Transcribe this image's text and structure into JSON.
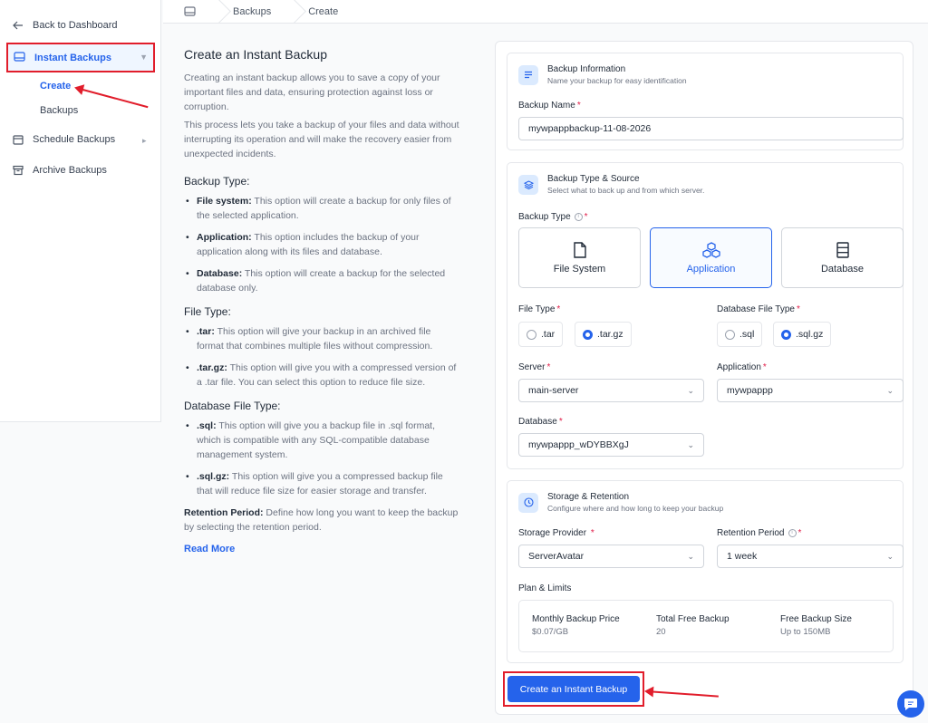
{
  "sidebar": {
    "back_label": "Back to Dashboard",
    "instant_backups_label": "Instant Backups",
    "sub_items": [
      "Create",
      "Backups"
    ],
    "schedule_backups_label": "Schedule Backups",
    "archive_backups_label": "Archive Backups"
  },
  "breadcrumb": [
    "Backups",
    "Create"
  ],
  "info": {
    "title": "Create an Instant Backup",
    "intro1": "Creating an instant backup allows you to save a copy of your important files and data, ensuring protection against loss or corruption.",
    "intro2": "This process lets you take a backup of your files and data without interrupting its operation and will make the recovery easier from unexpected incidents.",
    "backup_type_heading": "Backup Type:",
    "backup_types": [
      {
        "term": "File system:",
        "desc": " This option will create a backup for only files of the selected application."
      },
      {
        "term": "Application:",
        "desc": " This option includes the backup of your application along with its files and database."
      },
      {
        "term": "Database:",
        "desc": " This option will create a backup for the selected database only."
      }
    ],
    "file_type_heading": "File Type:",
    "file_types": [
      {
        "term": ".tar:",
        "desc": " This option will give your backup in an archived file format that combines multiple files without compression."
      },
      {
        "term": ".tar.gz:",
        "desc": " This option will give you with a compressed version of a .tar file. You can select this option to reduce file size."
      }
    ],
    "db_file_type_heading": "Database File Type:",
    "db_file_types": [
      {
        "term": ".sql:",
        "desc": " This option will give you a backup file in .sql format, which is compatible with any SQL-compatible database management system."
      },
      {
        "term": ".sql.gz:",
        "desc": " This option will give you a compressed backup file that will reduce file size for easier storage and transfer."
      }
    ],
    "retention_term": "Retention Period:",
    "retention_desc": " Define how long you want to keep the backup by selecting the retention period.",
    "read_more": "Read More"
  },
  "form": {
    "backup_info": {
      "title": "Backup Information",
      "subtitle": "Name your backup for easy identification",
      "name_label": "Backup Name",
      "name_value": "mywpappbackup-11-08-2026"
    },
    "type_source": {
      "title": "Backup Type & Source",
      "subtitle": "Select what to back up and from which server.",
      "backup_type_label": "Backup Type",
      "types": [
        "File System",
        "Application",
        "Database"
      ],
      "selected_type": "Application",
      "file_type_label": "File Type",
      "file_types": [
        ".tar",
        ".tar.gz"
      ],
      "selected_file_type": ".tar.gz",
      "db_file_type_label": "Database File Type",
      "db_file_types": [
        ".sql",
        ".sql.gz"
      ],
      "selected_db_file_type": ".sql.gz",
      "server_label": "Server",
      "server_value": "main-server",
      "application_label": "Application",
      "application_value": "mywpappp",
      "database_label": "Database",
      "database_value": "mywpappp_wDYBBXgJ"
    },
    "storage": {
      "title": "Storage & Retention",
      "subtitle": "Configure where and how long to keep your backup",
      "provider_label": "Storage Provider",
      "provider_value": "ServerAvatar",
      "retention_label": "Retention Period",
      "retention_value": "1 week",
      "plan_label": "Plan & Limits",
      "plan": [
        {
          "key": "Monthly Backup Price",
          "value": "$0.07/GB"
        },
        {
          "key": "Total Free Backup",
          "value": "20"
        },
        {
          "key": "Free Backup Size",
          "value": "Up to 150MB"
        }
      ]
    },
    "submit_label": "Create an Instant Backup",
    "required_mark": "*"
  },
  "colors": {
    "accent": "#2563eb",
    "annotation": "#e11d2b"
  }
}
